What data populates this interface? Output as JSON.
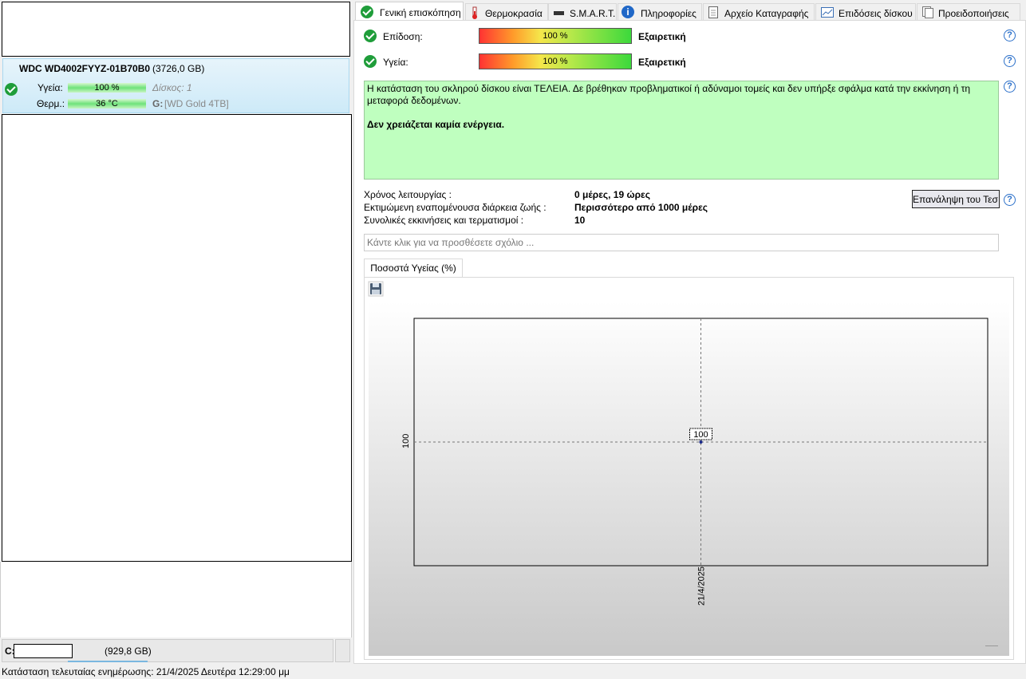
{
  "left": {
    "disk": {
      "name": "WDC WD4002FYYZ-01B70B0",
      "size": "(3726,0 GB)",
      "health_label": "Υγεία:",
      "health_value": "100 %",
      "temp_label": "Θερμ.:",
      "temp_value": "36 °C",
      "disk_index": "Δίσκος: 1",
      "volume_letter": "G:",
      "volume_name": "[WD Gold 4TB]"
    },
    "bottom_volume": {
      "letter": "C:",
      "size": "(929,8 GB)"
    }
  },
  "tabs": [
    {
      "label": "Γενική επισκόπηση",
      "icon": "check-icon"
    },
    {
      "label": "Θερμοκρασία",
      "icon": "thermometer-icon"
    },
    {
      "label": "S.M.A.R.T.",
      "icon": "drive-icon"
    },
    {
      "label": "Πληροφορίες",
      "icon": "info-icon"
    },
    {
      "label": "Αρχείο Καταγραφής",
      "icon": "document-icon"
    },
    {
      "label": "Επιδόσεις δίσκου",
      "icon": "chart-icon"
    },
    {
      "label": "Προειδοποιήσεις",
      "icon": "alerts-icon"
    }
  ],
  "overview": {
    "performance_label": "Επίδοση:",
    "performance_value": "100 %",
    "performance_rating": "Εξαιρετική",
    "health_label": "Υγεία:",
    "health_value": "100 %",
    "health_rating": "Εξαιρετική",
    "status_message": "Η κατάσταση του σκληρού δίσκου είναι ΤΕΛΕΙΑ. Δε βρέθηκαν προβληματικοί ή αδύναμοι τομείς και δεν υπήρξε σφάλμα κατά την εκκίνηση ή τη μεταφορά δεδομένων.",
    "action_message": "Δεν χρειάζεται καμία ενέργεια.",
    "uptime_label": "Χρόνος λειτουργίας :",
    "uptime_value": "0 μέρες, 19 ώρες",
    "lifetime_label": "Εκτιμώμενη εναπομένουσα διάρκεια ζωής :",
    "lifetime_value": "Περισσότερο από 1000 μέρες",
    "startups_label": "Συνολικές εκκινήσεις και τερματισμοί :",
    "startups_value": "10",
    "retest_button": "Επανάληψη του Τεσ",
    "comment_placeholder": "Κάντε κλικ για να προσθέσετε σχόλιο ..."
  },
  "chart_tab_label": "Ποσοστά Υγείας (%)",
  "chart_data": {
    "type": "line",
    "x": [
      "21/4/2025"
    ],
    "series": [
      {
        "values": [
          100
        ]
      }
    ],
    "ylabel": "",
    "xlabel": "",
    "data_labels": [
      "100"
    ],
    "y_tick_labels": [
      "100"
    ],
    "x_tick_labels": [
      "21/4/2025"
    ],
    "grid": true
  },
  "statusbar": {
    "text": "Κατάσταση τελευταίας ενημέρωσης: 21/4/2025 Δευτέρα 12:29:00 μμ"
  },
  "colors": {
    "healthy": "#1f9d3a",
    "status_bg": "#bfffbf",
    "selected_bg": "#cdeaf8",
    "help": "#2a6fc9"
  }
}
